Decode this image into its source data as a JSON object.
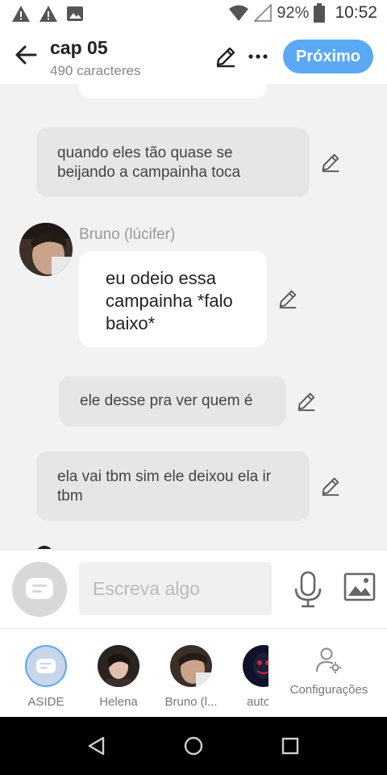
{
  "status_bar": {
    "battery_percent": "92%",
    "time": "10:52"
  },
  "header": {
    "title": "cap 05",
    "subtitle": "490 caracteres",
    "next_label": "Próximo"
  },
  "messages": [
    {
      "type": "narration",
      "text": "quando eles tão  quase se beijando a campainha toca"
    },
    {
      "type": "character",
      "character": "Bruno (lúcifer)",
      "text": "eu odeio essa campainha *falo baixo*"
    },
    {
      "type": "narration",
      "text": "ele desse pra ver quem é"
    },
    {
      "type": "narration",
      "text": "ela vai tbm sim ele deixou ela ir tbm"
    }
  ],
  "input": {
    "placeholder": "Escreva algo"
  },
  "characters": [
    {
      "label": "ASIDE"
    },
    {
      "label": "Helena"
    },
    {
      "label": "Bruno (l..."
    },
    {
      "label": "auto"
    }
  ],
  "settings_label": "Configurações",
  "colors": {
    "accent": "#5ba8f5",
    "narration_bubble": "#e6e6e6",
    "character_bubble": "#ffffff"
  }
}
